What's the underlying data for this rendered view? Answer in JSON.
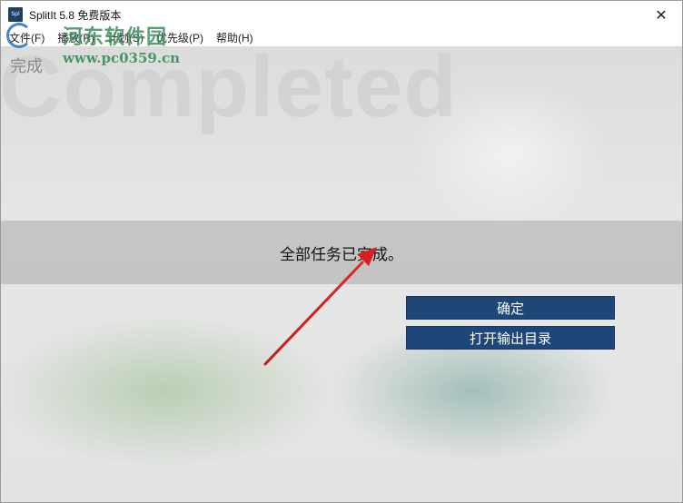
{
  "window": {
    "title": "SplitIt 5.8 免费版本",
    "app_icon_text": "Spl",
    "close_symbol": "✕"
  },
  "menu": {
    "items": [
      {
        "label": "文件(F)"
      },
      {
        "label": "播放(R)"
      },
      {
        "label": "计划(S)"
      },
      {
        "label": "优先级(P)"
      },
      {
        "label": "帮助(H)"
      }
    ]
  },
  "content": {
    "background_word": "Completed",
    "header_label": "完成",
    "status_message": "全部任务已完成。"
  },
  "buttons": {
    "ok_label": "确定",
    "open_dir_label": "打开输出目录"
  },
  "watermark": {
    "site_name": "河东软件园",
    "url": "www.pc0359.cn"
  },
  "colors": {
    "button_bg": "#1e4679",
    "arrow": "#d62020",
    "status_band": "#bebebe"
  },
  "icons": {
    "close": "close-icon",
    "app": "app-icon",
    "annotation": "red-arrow-icon"
  }
}
